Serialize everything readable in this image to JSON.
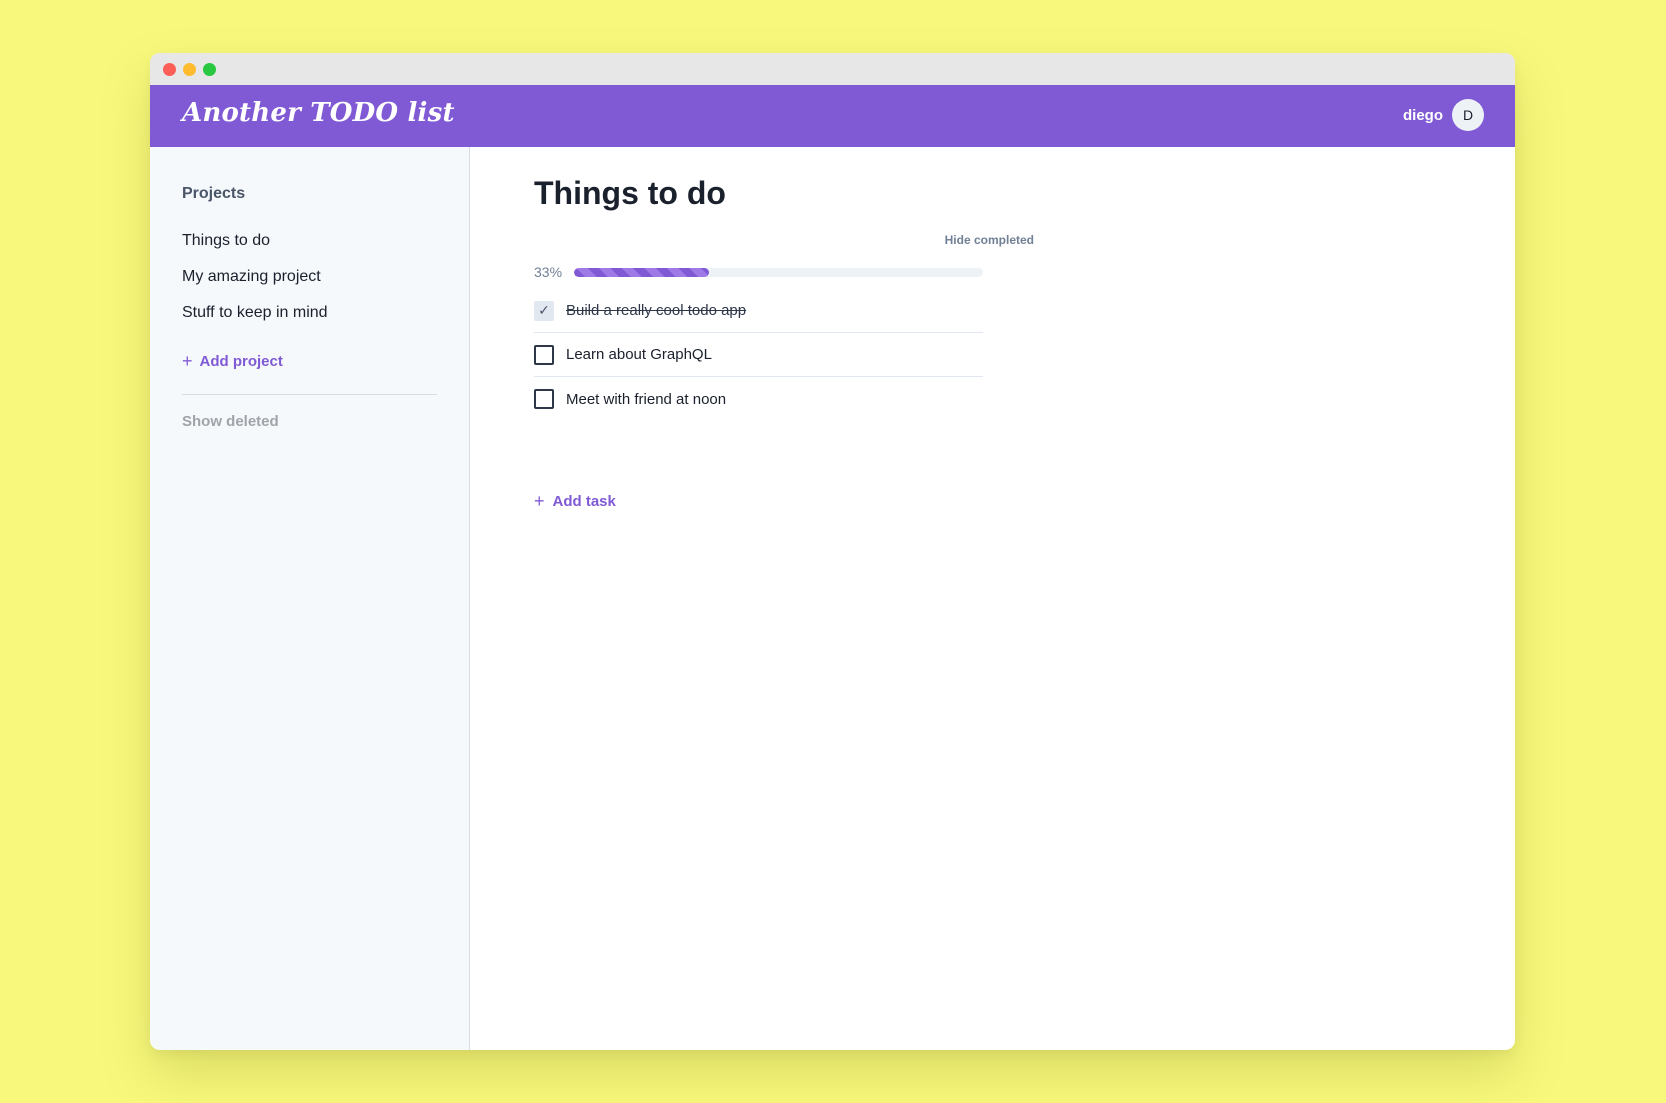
{
  "app": {
    "brand": "Another TODO list",
    "accent": "#805ad5",
    "background": "#f8f97c"
  },
  "user": {
    "name": "diego",
    "initial": "D"
  },
  "sidebar": {
    "heading": "Projects",
    "projects": [
      {
        "label": "Things to do"
      },
      {
        "label": "My amazing project"
      },
      {
        "label": "Stuff to keep in mind"
      }
    ],
    "add_project_label": "Add project",
    "show_deleted_label": "Show deleted"
  },
  "main": {
    "title": "Things to do",
    "hide_completed_label": "Hide completed",
    "progress": {
      "label": "33%",
      "value": 0.33
    },
    "tasks": [
      {
        "label": "Build a really cool todo app",
        "completed": true
      },
      {
        "label": "Learn about GraphQL",
        "completed": false
      },
      {
        "label": "Meet with friend at noon",
        "completed": false
      }
    ],
    "add_task_label": "Add task"
  }
}
